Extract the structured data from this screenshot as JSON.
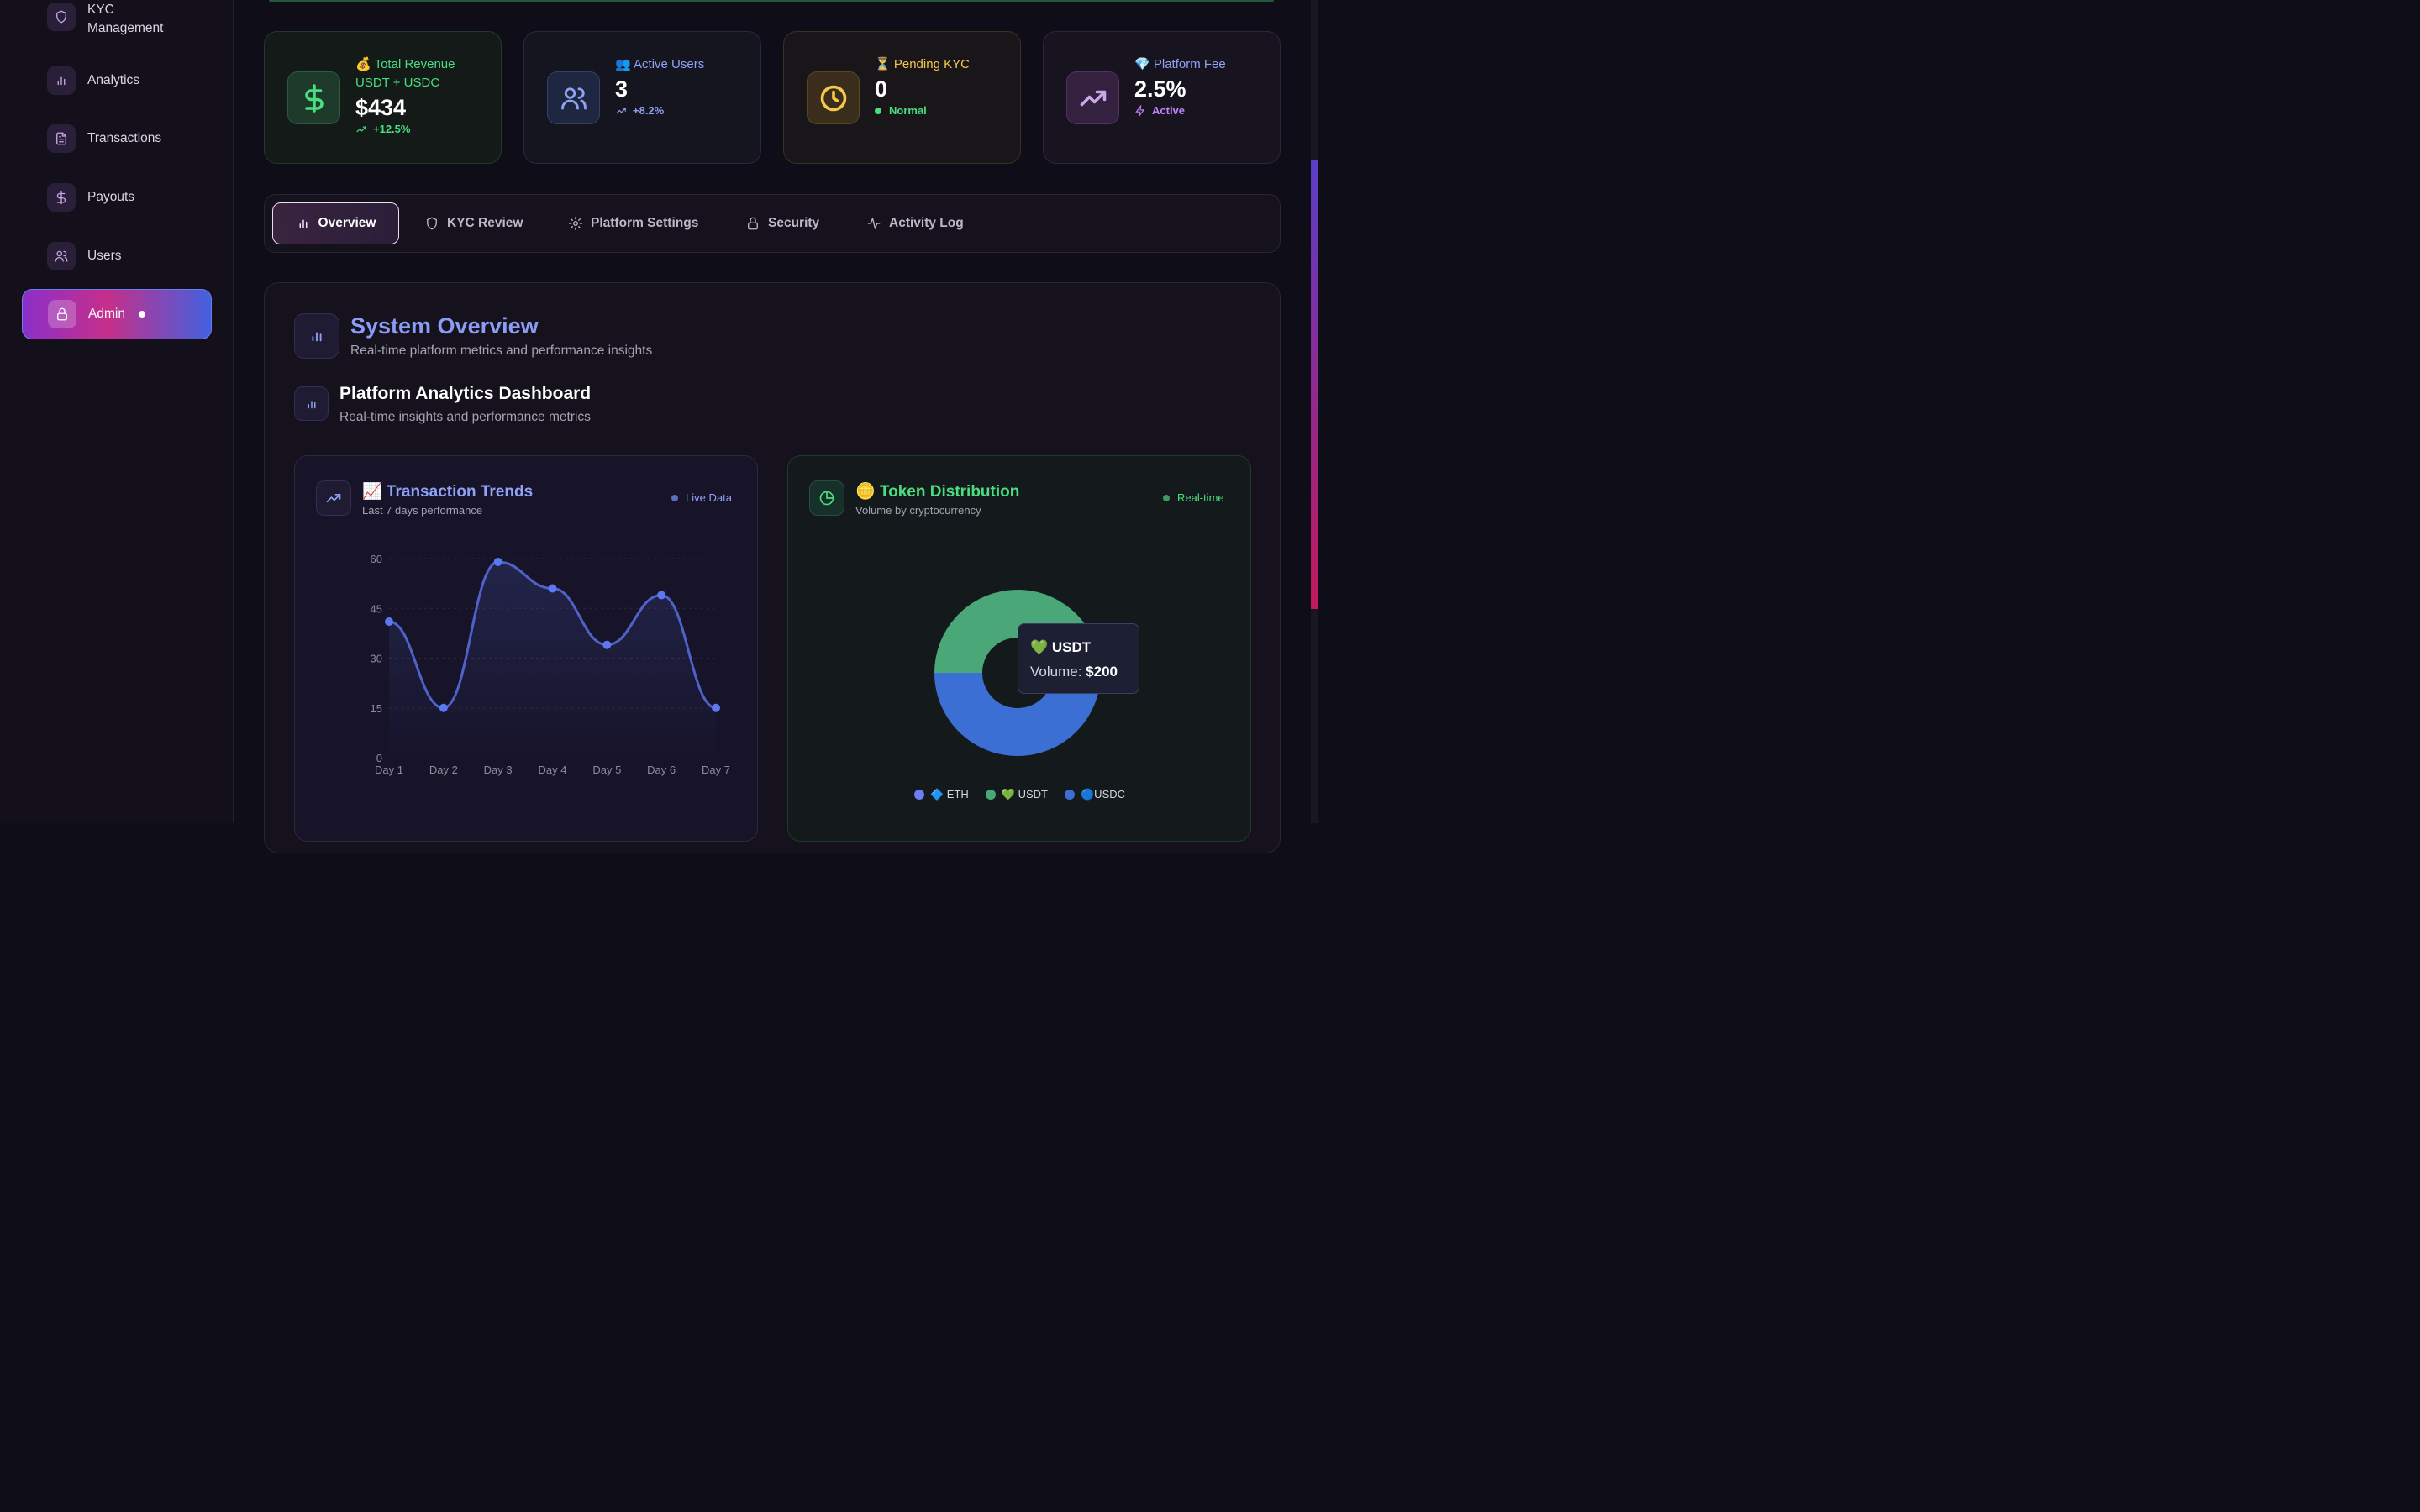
{
  "sidebar": {
    "items": [
      {
        "label": "KYC\nManagement",
        "icon": "shield-icon"
      },
      {
        "label": "Analytics",
        "icon": "bar-chart-icon"
      },
      {
        "label": "Transactions",
        "icon": "document-icon"
      },
      {
        "label": "Payouts",
        "icon": "dollar-icon"
      },
      {
        "label": "Users",
        "icon": "users-icon"
      },
      {
        "label": "Admin",
        "icon": "lock-icon",
        "active": true
      }
    ]
  },
  "stats": [
    {
      "emoji": "💰",
      "label": "Total Revenue",
      "label2": "USDT + USDC",
      "value": "$434",
      "sub": "+12.5%",
      "color": "#4ade80"
    },
    {
      "emoji": "👥",
      "label": "Active Users",
      "value": "3",
      "sub": "+8.2%",
      "color": "#8fa2f5"
    },
    {
      "emoji": "⏳",
      "label": "Pending KYC",
      "value": "0",
      "sub": "Normal",
      "color": "#f5c84b"
    },
    {
      "emoji": "💎",
      "label": "Platform Fee",
      "value": "2.5%",
      "sub": "Active",
      "color": "#c084fc"
    }
  ],
  "tabs": [
    {
      "label": "Overview",
      "active": true
    },
    {
      "label": "KYC Review"
    },
    {
      "label": "Platform Settings"
    },
    {
      "label": "Security"
    },
    {
      "label": "Activity Log"
    }
  ],
  "overview": {
    "title": "System Overview",
    "subtitle": "Real-time platform metrics and performance insights",
    "dashboard_title": "Platform Analytics Dashboard",
    "dashboard_subtitle": "Real-time insights and performance metrics"
  },
  "trends_card": {
    "title": "📈 Transaction Trends",
    "subtitle": "Last 7 days performance",
    "badge": "Live Data"
  },
  "token_card": {
    "title": "🪙 Token Distribution",
    "subtitle": "Volume by cryptocurrency",
    "badge": "Real-time"
  },
  "tooltip": {
    "title": "💚 USDT",
    "label": "Volume: ",
    "value": "$200"
  },
  "chart_data": [
    {
      "type": "line",
      "categories": [
        "Day 1",
        "Day 2",
        "Day 3",
        "Day 4",
        "Day 5",
        "Day 6",
        "Day 7"
      ],
      "values": [
        41,
        15,
        59,
        51,
        34,
        49,
        15
      ],
      "ylim": [
        0,
        60
      ],
      "yticks": [
        "0",
        "15",
        "30",
        "45",
        "60"
      ],
      "grid": true,
      "color": "#5b78f0"
    },
    {
      "type": "pie",
      "slices": [
        {
          "label": "🔷 ETH",
          "value": 0,
          "color": "#6f7cf2"
        },
        {
          "label": "💚 USDT",
          "value": 200,
          "color": "#4aa878"
        },
        {
          "label": "🔵USDC",
          "value": 234,
          "color": "#3b6fd4"
        }
      ]
    }
  ]
}
